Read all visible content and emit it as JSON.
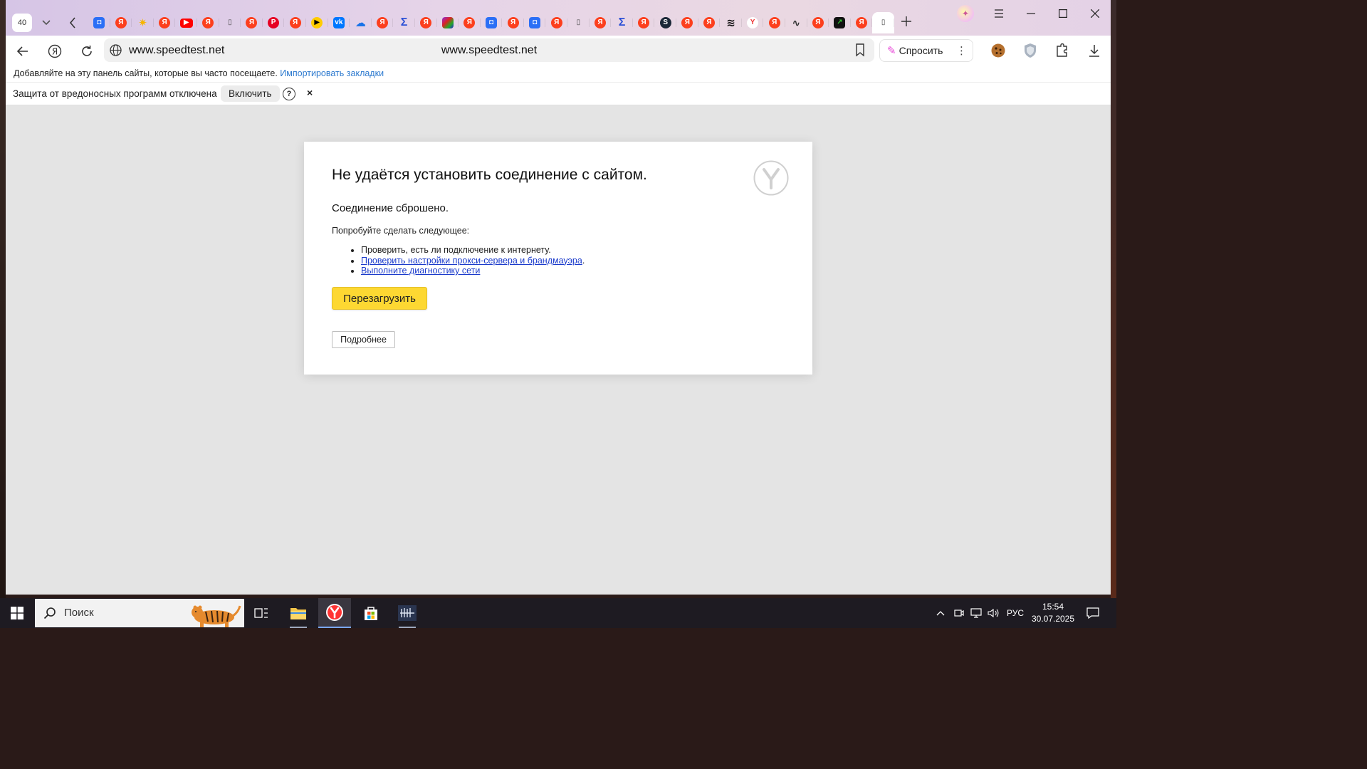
{
  "tabstrip": {
    "tab_count": "40",
    "tabs": [
      {
        "icon": "blue-square-icon",
        "glyph": "◘",
        "cls": "fav-blue"
      },
      {
        "icon": "yandex-icon",
        "glyph": "Я",
        "cls": "fav-ya"
      },
      {
        "icon": "sun-icon",
        "glyph": "✷",
        "cls": "fav-sun"
      },
      {
        "icon": "yandex-icon",
        "glyph": "Я",
        "cls": "fav-ya"
      },
      {
        "icon": "youtube-icon",
        "glyph": "▶",
        "cls": "fav-yt"
      },
      {
        "icon": "yandex-icon",
        "glyph": "Я",
        "cls": "fav-ya"
      },
      {
        "icon": "document-icon",
        "glyph": "▯",
        "cls": "fav-doc"
      },
      {
        "icon": "yandex-icon",
        "glyph": "Я",
        "cls": "fav-ya"
      },
      {
        "icon": "pinterest-icon",
        "glyph": "P",
        "cls": "fav-pin"
      },
      {
        "icon": "yandex-icon",
        "glyph": "Я",
        "cls": "fav-ya"
      },
      {
        "icon": "dzen-play-icon",
        "glyph": "▶",
        "cls": "fav-dzen"
      },
      {
        "icon": "vk-icon",
        "glyph": "vk",
        "cls": "fav-vk"
      },
      {
        "icon": "cloud-icon",
        "glyph": "☁",
        "cls": "fav-cloud"
      },
      {
        "icon": "yandex-icon",
        "glyph": "Я",
        "cls": "fav-ya"
      },
      {
        "icon": "sigma-icon",
        "glyph": "Σ",
        "cls": "fav-arrow"
      },
      {
        "icon": "yandex-icon",
        "glyph": "Я",
        "cls": "fav-ya"
      },
      {
        "icon": "winrar-icon",
        "glyph": "",
        "cls": "fav-rar"
      },
      {
        "icon": "yandex-icon",
        "glyph": "Я",
        "cls": "fav-ya"
      },
      {
        "icon": "blue-square-icon",
        "glyph": "◘",
        "cls": "fav-blue"
      },
      {
        "icon": "yandex-icon",
        "glyph": "Я",
        "cls": "fav-ya"
      },
      {
        "icon": "blue-square-icon",
        "glyph": "◘",
        "cls": "fav-blue"
      },
      {
        "icon": "yandex-icon",
        "glyph": "Я",
        "cls": "fav-ya"
      },
      {
        "icon": "document-icon",
        "glyph": "▯",
        "cls": "fav-doc"
      },
      {
        "icon": "yandex-icon",
        "glyph": "Я",
        "cls": "fav-ya"
      },
      {
        "icon": "sigma-icon",
        "glyph": "Σ",
        "cls": "fav-arrow"
      },
      {
        "icon": "yandex-icon",
        "glyph": "Я",
        "cls": "fav-ya"
      },
      {
        "icon": "steam-icon",
        "glyph": "S",
        "cls": "fav-steam"
      },
      {
        "icon": "yandex-icon",
        "glyph": "Я",
        "cls": "fav-ya"
      },
      {
        "icon": "yandex-icon",
        "glyph": "Я",
        "cls": "fav-ya"
      },
      {
        "icon": "stack-icon",
        "glyph": "≋",
        "cls": "fav-stack"
      },
      {
        "icon": "yandex-browser-icon",
        "glyph": "Y",
        "cls": "fav-ybrowser"
      },
      {
        "icon": "yandex-icon",
        "glyph": "Я",
        "cls": "fav-ya"
      },
      {
        "icon": "pulse-icon",
        "glyph": "∿",
        "cls": "fav-pulse"
      },
      {
        "icon": "yandex-icon",
        "glyph": "Я",
        "cls": "fav-ya"
      },
      {
        "icon": "chart-icon",
        "glyph": "↗",
        "cls": "fav-chart"
      },
      {
        "icon": "yandex-icon",
        "glyph": "Я",
        "cls": "fav-ya"
      },
      {
        "icon": "document-icon",
        "glyph": "▯",
        "cls": "fav-doc",
        "active": true
      }
    ]
  },
  "toolbar": {
    "url": "www.speedtest.net",
    "url_center": "www.speedtest.net",
    "ask_label": "Спросить"
  },
  "bookmarks": {
    "hint": "Добавляйте на эту панель сайты, которые вы часто посещаете.",
    "import_link": "Импортировать закладки"
  },
  "infobar": {
    "message": "Защита от вредоносных программ отключена",
    "enable_label": "Включить",
    "help": "?",
    "close": "×"
  },
  "error": {
    "title": "Не удаётся установить соединение с сайтом.",
    "subtitle": "Соединение сброшено.",
    "try_heading": "Попробуйте сделать следующее:",
    "suggestion_1": "Проверить, есть ли подключение к интернету.",
    "suggestion_2": "Проверить настройки прокси-сервера и брандмауэра",
    "suggestion_3": "Выполните диагностику сети",
    "reload_label": "Перезагрузить",
    "details_label": "Подробнее"
  },
  "taskbar": {
    "search_label": "Поиск",
    "language": "РУС",
    "time": "15:54",
    "date": "30.07.2025"
  },
  "colors": {
    "reload_button": "#fdd832",
    "link": "#1a3acb",
    "import_link": "#2d7acf",
    "taskbar": "#1e1b22"
  }
}
